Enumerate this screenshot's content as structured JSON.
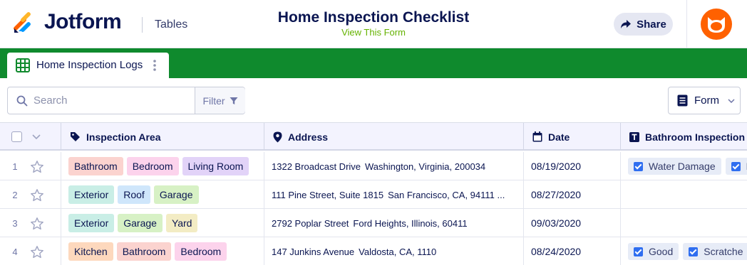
{
  "header": {
    "brand": "Jotform",
    "section": "Tables",
    "form_title": "Home Inspection Checklist",
    "form_link": "View This Form",
    "share_label": "Share",
    "brand_colors": [
      "#ff6100",
      "#0099ff",
      "#ffb629",
      "#0a1551"
    ]
  },
  "tab": {
    "label": "Home Inspection Logs",
    "icon": "table-grid-icon"
  },
  "toolbar": {
    "search_placeholder": "Search",
    "filter_label": "Filter",
    "form_label": "Form"
  },
  "table": {
    "columns": [
      {
        "label": "Inspection Area",
        "icon": "tag-icon"
      },
      {
        "label": "Address",
        "icon": "location-pin-icon"
      },
      {
        "label": "Date",
        "icon": "calendar-icon"
      },
      {
        "label": "Bathroom Inspection",
        "icon": "text-t-icon"
      }
    ],
    "rows": [
      {
        "num": "1",
        "areas": [
          {
            "label": "Bathroom",
            "color": "#fbd3cf"
          },
          {
            "label": "Bedroom",
            "color": "#fcd3ec"
          },
          {
            "label": "Living Room",
            "color": "#e2d3f8"
          }
        ],
        "street": "1322 Broadcast Drive",
        "city": "Washington, Virginia, 200034",
        "date": "08/19/2020",
        "checks": [
          "Water Damage",
          "Repa"
        ]
      },
      {
        "num": "2",
        "areas": [
          {
            "label": "Exterior",
            "color": "#c9eee6"
          },
          {
            "label": "Roof",
            "color": "#cfe6fb"
          },
          {
            "label": "Garage",
            "color": "#d7f1c5"
          }
        ],
        "street": "111 Pine Street, Suite 1815",
        "city": "San Francisco, CA, 94111 ...",
        "date": "08/27/2020",
        "checks": []
      },
      {
        "num": "3",
        "areas": [
          {
            "label": "Exterior",
            "color": "#c9eee6"
          },
          {
            "label": "Garage",
            "color": "#d7f1c5"
          },
          {
            "label": "Yard",
            "color": "#f3ecc4"
          }
        ],
        "street": "2792 Poplar Street",
        "city": "Ford Heights, Illinois, 60411",
        "date": "09/03/2020",
        "checks": []
      },
      {
        "num": "4",
        "areas": [
          {
            "label": "Kitchen",
            "color": "#fdd8bd"
          },
          {
            "label": "Bathroom",
            "color": "#fbd3cf"
          },
          {
            "label": "Bedroom",
            "color": "#fcd3ec"
          }
        ],
        "street": "147 Junkins Avenue",
        "city": "Valdosta, CA, 1110",
        "date": "08/24/2020",
        "checks": [
          "Good",
          "Scratche"
        ]
      }
    ]
  }
}
